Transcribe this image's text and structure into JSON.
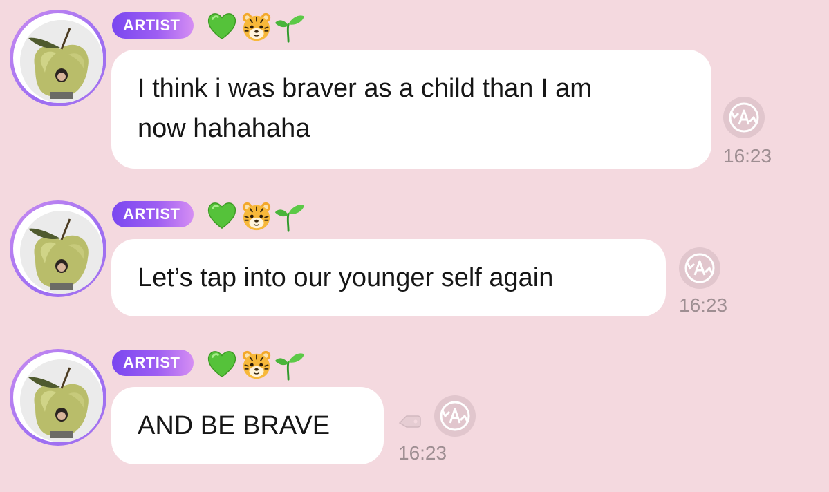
{
  "messages": [
    {
      "badge": "ARTIST",
      "emojis": [
        "green-heart",
        "tiger-face",
        "seedling"
      ],
      "text_lines": [
        "I think i was braver as a child than I am",
        "now hahahaha"
      ],
      "time": "16:23",
      "translate_icon": "translate-a-icon"
    },
    {
      "badge": "ARTIST",
      "emojis": [
        "green-heart",
        "tiger-face",
        "seedling"
      ],
      "text_lines": [
        "Let’s tap into our younger self again"
      ],
      "time": "16:23",
      "translate_icon": "translate-a-icon"
    },
    {
      "badge": "ARTIST",
      "emojis": [
        "green-heart",
        "tiger-face",
        "seedling"
      ],
      "text_lines": [
        "AND BE BRAVE"
      ],
      "time": "16:23",
      "translate_icon": "translate-a-icon",
      "extra_icon": "tag-icon"
    }
  ],
  "colors": {
    "background": "#f4d9df",
    "bubble": "#ffffff",
    "badge_start": "#7a47f0",
    "badge_end": "#d58ef3",
    "timestamp": "#9e8e92"
  }
}
